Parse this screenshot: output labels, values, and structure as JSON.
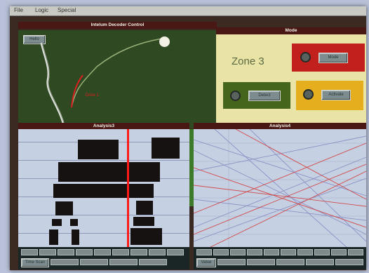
{
  "menu": [
    "File",
    "Logic",
    "Special"
  ],
  "field": {
    "title": "Intelum Decoder Control",
    "button_label": "Hello",
    "marker_label": "Drive 1"
  },
  "mode": {
    "title": "Mode",
    "zone_text": "Zone 3",
    "buttons": [
      "Mode",
      "Detect",
      "Activate"
    ]
  },
  "analysis_left": {
    "title": "Analysis3"
  },
  "analysis_right": {
    "title": "Analysis4"
  },
  "bottom_left_label": "Time Scan",
  "bottom_right_label": "Value",
  "colors": {
    "field": "#2f4a22",
    "mode_panel": "#e9e3a6",
    "alert_red": "#c2201c",
    "alert_yellow": "#e5ae1e",
    "mode_green": "#46651c",
    "cursor": "#ff1a1a",
    "trace_red": "#cf4a4a",
    "trace_blue": "#8c93c3"
  }
}
